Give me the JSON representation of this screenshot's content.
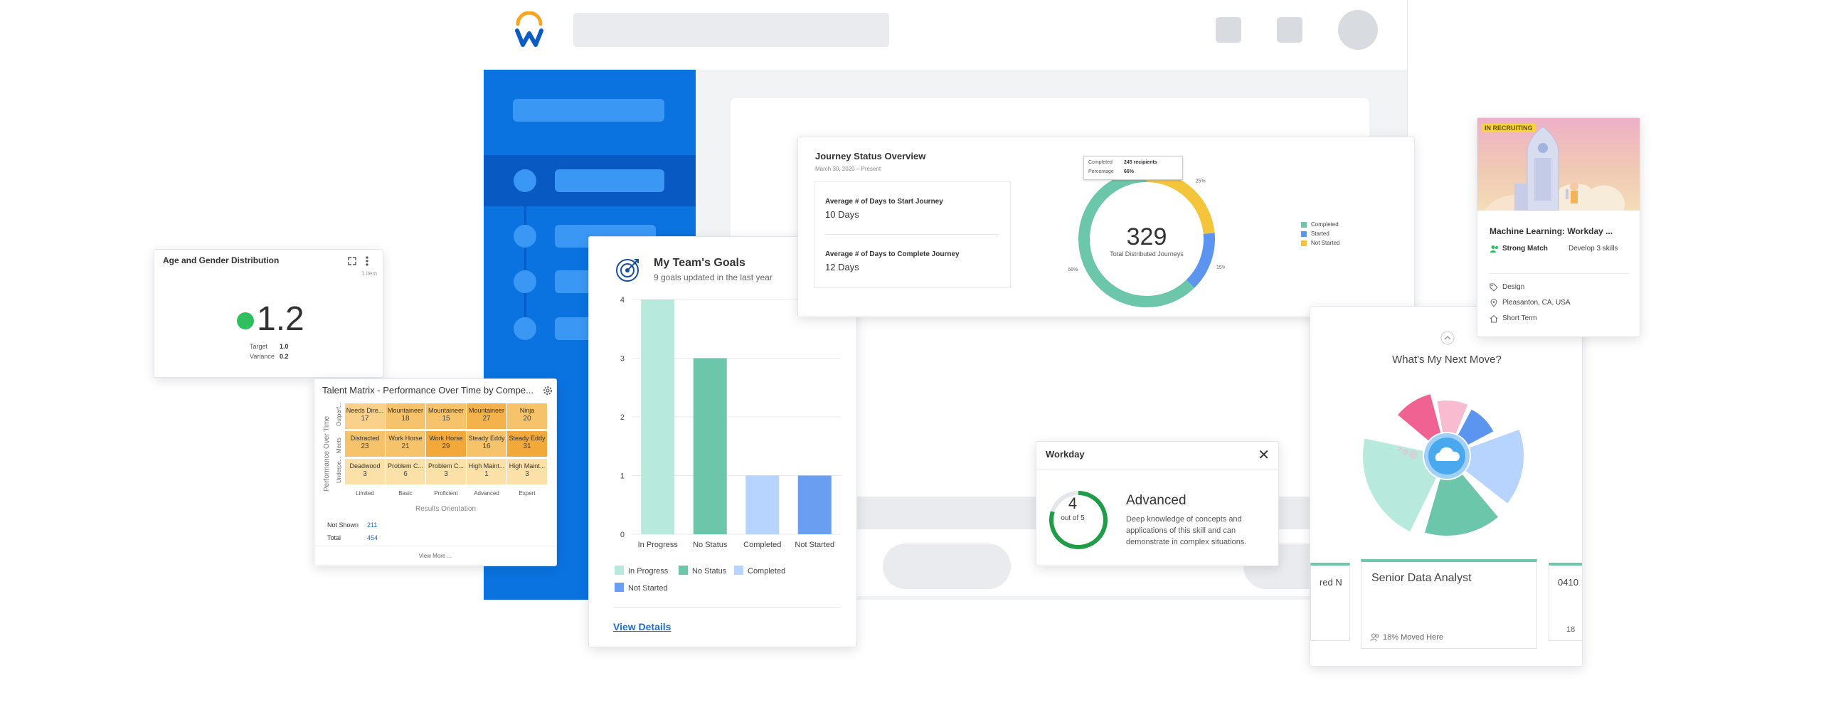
{
  "colors": {
    "brand_blue": "#0a73e0",
    "teal": "#6cc7aa",
    "light_teal": "#b7eadc",
    "light_blue": "#b7d3ff",
    "mid_blue": "#6a9ef0",
    "yellow": "#f4c43b",
    "green": "#2fbf5f"
  },
  "icons": {
    "logo": "workday-w-logo",
    "expand": "expand-icon",
    "more": "more-vertical-icon",
    "settings": "gear-icon",
    "goals": "target-icon",
    "close": "close-icon",
    "tag": "tag-icon",
    "location": "location-pin-icon",
    "home": "home-icon",
    "people": "people-icon",
    "collapse": "chevron-up-icon"
  },
  "age_card": {
    "title": "Age and Gender Distribution",
    "subtitle": "1 item",
    "value": "1.2",
    "target_label": "Target",
    "target_value": "1.0",
    "variance_label": "Variance",
    "variance_value": "0.2"
  },
  "talent": {
    "title": "Talent Matrix - Performance Over Time by Compe...",
    "y_axis": "Performance Over Time",
    "row_labels": [
      "Outperf...",
      "Meets",
      "Underpe..."
    ],
    "x_axis": "Results Orientation",
    "columns": [
      "Limited",
      "Basic",
      "Proficient",
      "Advanced",
      "Expert"
    ],
    "rows": [
      [
        {
          "l": "Needs Dire...",
          "v": "17",
          "c": "#f9d18a"
        },
        {
          "l": "Mountaineer",
          "v": "18",
          "c": "#f6c26a"
        },
        {
          "l": "Mountaineer",
          "v": "15",
          "c": "#f6c26a"
        },
        {
          "l": "Mountaineer",
          "v": "27",
          "c": "#f4b24a"
        },
        {
          "l": "Ninja",
          "v": "20",
          "c": "#f6c26a"
        }
      ],
      [
        {
          "l": "Distracted",
          "v": "23",
          "c": "#f6c26a"
        },
        {
          "l": "Work Horse",
          "v": "21",
          "c": "#f6c26a"
        },
        {
          "l": "Work Horse",
          "v": "29",
          "c": "#f3a93a"
        },
        {
          "l": "Steady Eddy",
          "v": "16",
          "c": "#f6c26a"
        },
        {
          "l": "Steady Eddy",
          "v": "31",
          "c": "#f3a93a"
        }
      ],
      [
        {
          "l": "Deadwood",
          "v": "3",
          "c": "#fbe0a8"
        },
        {
          "l": "Problem C...",
          "v": "6",
          "c": "#fbe0a8"
        },
        {
          "l": "Problem C...",
          "v": "3",
          "c": "#fbe0a8"
        },
        {
          "l": "High Maint...",
          "v": "1",
          "c": "#fbe0a8"
        },
        {
          "l": "High Maint...",
          "v": "3",
          "c": "#fbe0a8"
        }
      ]
    ],
    "not_shown_label": "Not Shown",
    "not_shown_value": "211",
    "total_label": "Total",
    "total_value": "454",
    "view_more": "View More ..."
  },
  "goals": {
    "title": "My Team's Goals",
    "subtitle": "9 goals updated in the last year",
    "view_details": "View Details",
    "chart_data": {
      "type": "bar",
      "categories": [
        "In Progress",
        "No Status",
        "Completed",
        "Not Started"
      ],
      "values": [
        4,
        3,
        1,
        1
      ],
      "colors": [
        "#b7eadc",
        "#6cc7aa",
        "#b7d3ff",
        "#6a9ef0"
      ],
      "ylim": [
        0,
        4
      ],
      "yticks": [
        "0",
        "1",
        "2",
        "3",
        "4"
      ],
      "legend": [
        "In Progress",
        "No Status",
        "Completed",
        "Not Started"
      ],
      "grid": true,
      "legend_position": "bottom"
    }
  },
  "journey": {
    "title": "Journey Status Overview",
    "date": "March 30, 2020 – Present",
    "metric1_label": "Average # of Days to Start Journey",
    "metric1_value": "10 Days",
    "metric2_label": "Average # of Days to Complete Journey",
    "metric2_value": "12 Days",
    "tooltip_l1": "Completed",
    "tooltip_v1": "245 recipients",
    "tooltip_l2": "Percentage",
    "tooltip_v2": "66%",
    "chart_data": {
      "type": "pie",
      "categories": [
        "Completed",
        "Started",
        "Not Started"
      ],
      "values": [
        66,
        15,
        25
      ],
      "colors": [
        "#6cc7aa",
        "#5b95ef",
        "#f4c43b"
      ],
      "center_value": "329",
      "center_label": "Total Distributed Journeys",
      "slice_labels": [
        "66%",
        "15%",
        "25%"
      ],
      "legend": [
        "Completed",
        "Started",
        "Not Started"
      ],
      "legend_position": "right"
    }
  },
  "recruit": {
    "badge": "IN RECRUITING",
    "title": "Machine Learning: Workday ...",
    "match": "Strong Match",
    "develop": "Develop 3 skills",
    "tag": "Design",
    "location": "Pleasanton, CA, USA",
    "term": "Short Term"
  },
  "move": {
    "title": "What's My Next Move?",
    "job_title": "Senior Data Analyst",
    "job_stat": "18% Moved Here",
    "left_job": "red N",
    "right_job": "0410",
    "right_stat": "18"
  },
  "workday": {
    "title": "Workday",
    "num": "4",
    "of": "out of 5",
    "level": "Advanced",
    "description": "Deep knowledge of concepts and applications of this skill and can demonstrate in complex situations.",
    "rating": 0.8
  }
}
